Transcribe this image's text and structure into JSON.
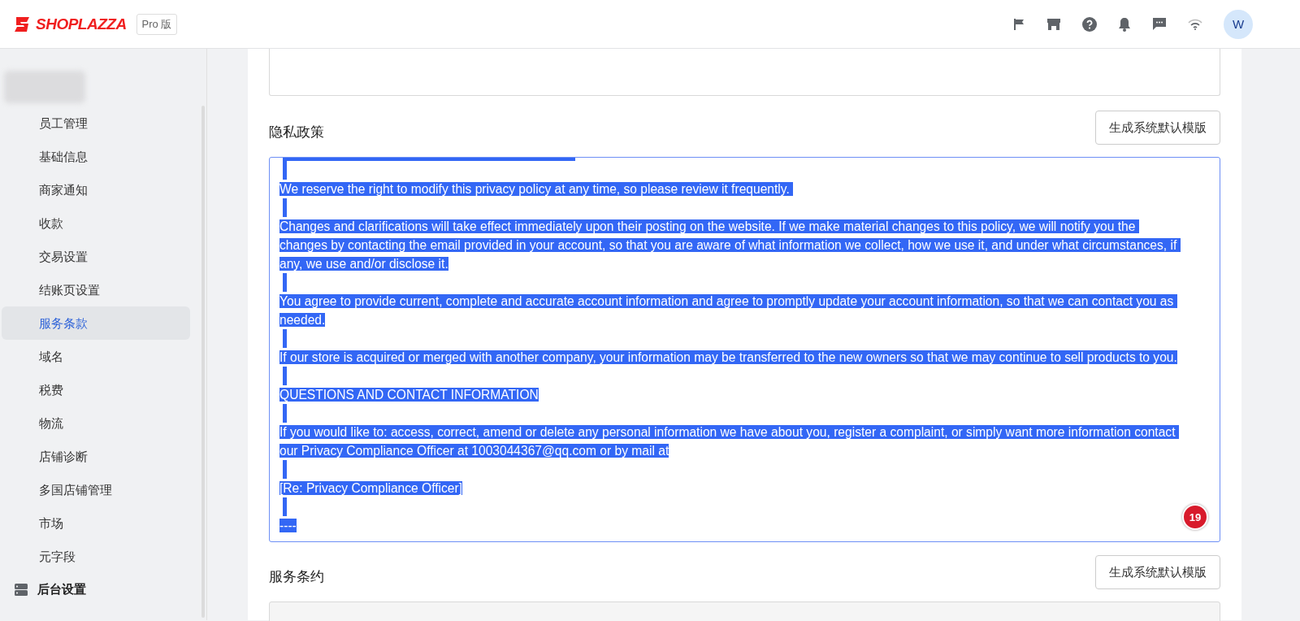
{
  "header": {
    "logo": "SHOPLAZZA",
    "edition": "Pro 版",
    "avatar": "W"
  },
  "sidebar": {
    "items": [
      {
        "label": "员工管理",
        "selected": false
      },
      {
        "label": "基础信息",
        "selected": false
      },
      {
        "label": "商家通知",
        "selected": false
      },
      {
        "label": "收款",
        "selected": false
      },
      {
        "label": "交易设置",
        "selected": false
      },
      {
        "label": "结账页设置",
        "selected": false
      },
      {
        "label": "服务条款",
        "selected": true
      },
      {
        "label": "域名",
        "selected": false
      },
      {
        "label": "税费",
        "selected": false
      },
      {
        "label": "物流",
        "selected": false
      },
      {
        "label": "店铺诊断",
        "selected": false
      },
      {
        "label": "多国店铺管理",
        "selected": false
      },
      {
        "label": "市场",
        "selected": false
      },
      {
        "label": "元字段",
        "selected": false
      }
    ],
    "section": {
      "label": "后台设置"
    }
  },
  "privacy": {
    "title": "隐私政策",
    "button": "生成系统默认模版",
    "lines": [
      {
        "kind": "blank"
      },
      {
        "kind": "text",
        "text": "We reserve the right to modify this privacy policy at any time, so please review it frequently. "
      },
      {
        "kind": "blank"
      },
      {
        "kind": "text",
        "text": "Changes and clarifications will take effect immediately upon their posting on the website. If we make material changes to this policy, we will notify you the "
      },
      {
        "kind": "text",
        "text": "changes by contacting the email provided in your account, so that you are aware of what information we collect, how we use it, and under what circumstances, if "
      },
      {
        "kind": "text",
        "text": "any, we use and/or disclose it."
      },
      {
        "kind": "blank"
      },
      {
        "kind": "text",
        "text": "You agree to provide current, complete and accurate account information and agree to promptly update your account information, so that we can contact you as "
      },
      {
        "kind": "text",
        "text": "needed."
      },
      {
        "kind": "blank"
      },
      {
        "kind": "text",
        "text": "If our store is acquired or merged with another company, your information may be transferred to the new owners so that we may continue to sell products to you."
      },
      {
        "kind": "blank"
      },
      {
        "kind": "text",
        "text": "QUESTIONS AND CONTACT INFORMATION"
      },
      {
        "kind": "blank"
      },
      {
        "kind": "text",
        "text": "If you would like to: access, correct, amend or delete any personal information we have about you, register a complaint, or simply want more information contact "
      },
      {
        "kind": "text",
        "text": "our Privacy Compliance Officer at 1003044367@qq.com or by mail at"
      },
      {
        "kind": "blank"
      },
      {
        "kind": "text",
        "text": "[Re: Privacy Compliance Officer]"
      },
      {
        "kind": "blank"
      },
      {
        "kind": "text",
        "text": "----"
      }
    ],
    "badge": "19"
  },
  "terms": {
    "title": "服务条约",
    "button": "生成系统默认模版"
  }
}
